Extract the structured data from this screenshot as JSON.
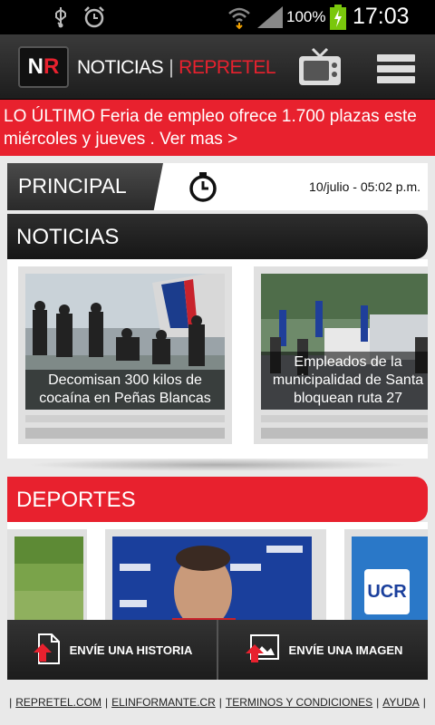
{
  "status_bar": {
    "battery_percent": "100%",
    "time": "17:03",
    "icons": [
      "usb-icon",
      "alarm-icon",
      "wifi-icon",
      "signal-icon",
      "battery-charging-icon"
    ]
  },
  "header": {
    "logo_n": "N",
    "logo_r": "R",
    "brand_left": "NOTICIAS",
    "brand_sep": "|",
    "brand_right": "REPRETEL",
    "icons": [
      "tv-icon",
      "menu-icon"
    ]
  },
  "ticker": {
    "text": "LO ÚLTIMO Feria de empleo ofrece 1.700 plazas este miércoles y jueves . Ver mas >"
  },
  "principal": {
    "label": "PRINCIPAL",
    "datetime": "10/julio - 05:02 p.m."
  },
  "noticias": {
    "title": "NOTICIAS",
    "cards": [
      {
        "caption": "Decomisan 300 kilos de cocaína en Peñas Blancas"
      },
      {
        "caption": "Empleados de la municipalidad de Santa bloquean ruta 27"
      }
    ]
  },
  "deportes": {
    "title": "DEPORTES",
    "partial_text": "UCR"
  },
  "actions": {
    "send_story": "ENVÍE UNA HISTORIA",
    "send_image": "ENVÍE UNA IMAGEN"
  },
  "footer": {
    "links": [
      "REPRETEL.COM",
      "ELINFORMANTE.CR",
      "TERMINOS Y CONDICIONES",
      "AYUDA"
    ],
    "separator": "|"
  },
  "colors": {
    "accent_red": "#e8212e",
    "dark": "#1d1d1d"
  }
}
